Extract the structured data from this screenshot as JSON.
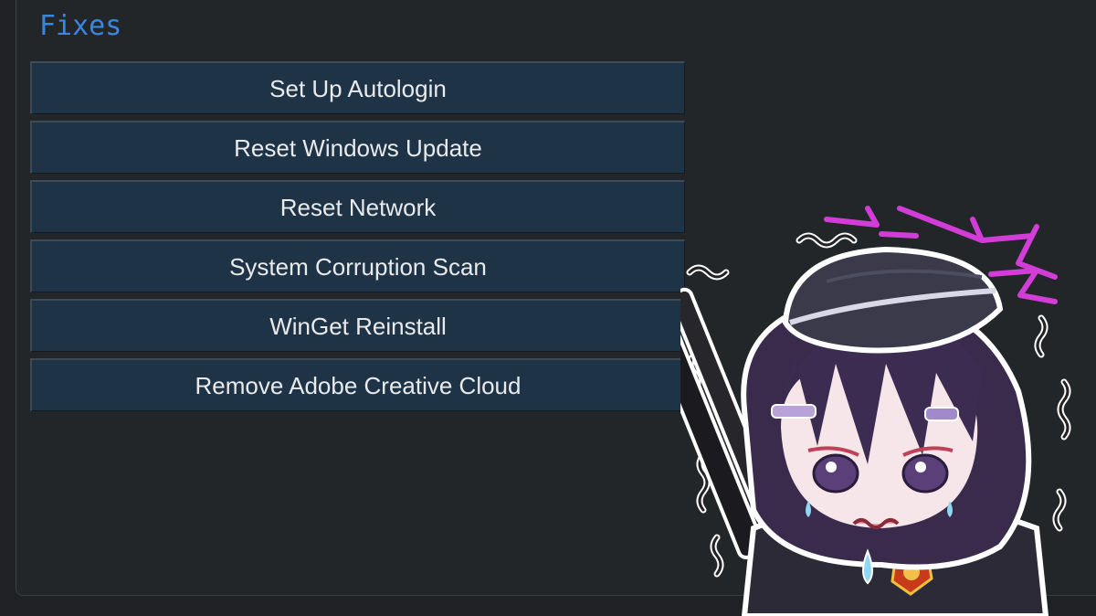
{
  "section": {
    "title": "Fixes"
  },
  "buttons": [
    {
      "label": "Set Up Autologin"
    },
    {
      "label": "Reset Windows Update"
    },
    {
      "label": "Reset Network"
    },
    {
      "label": "System Corruption Scan"
    },
    {
      "label": "WinGet Reinstall"
    },
    {
      "label": "Remove Adobe Creative Cloud"
    }
  ],
  "colors": {
    "background": "#1f2124",
    "title": "#3a86e0",
    "button_bg": "#1f3346",
    "button_text": "#e8eaec"
  },
  "sticker": {
    "icon": "anime-character-sticker"
  }
}
